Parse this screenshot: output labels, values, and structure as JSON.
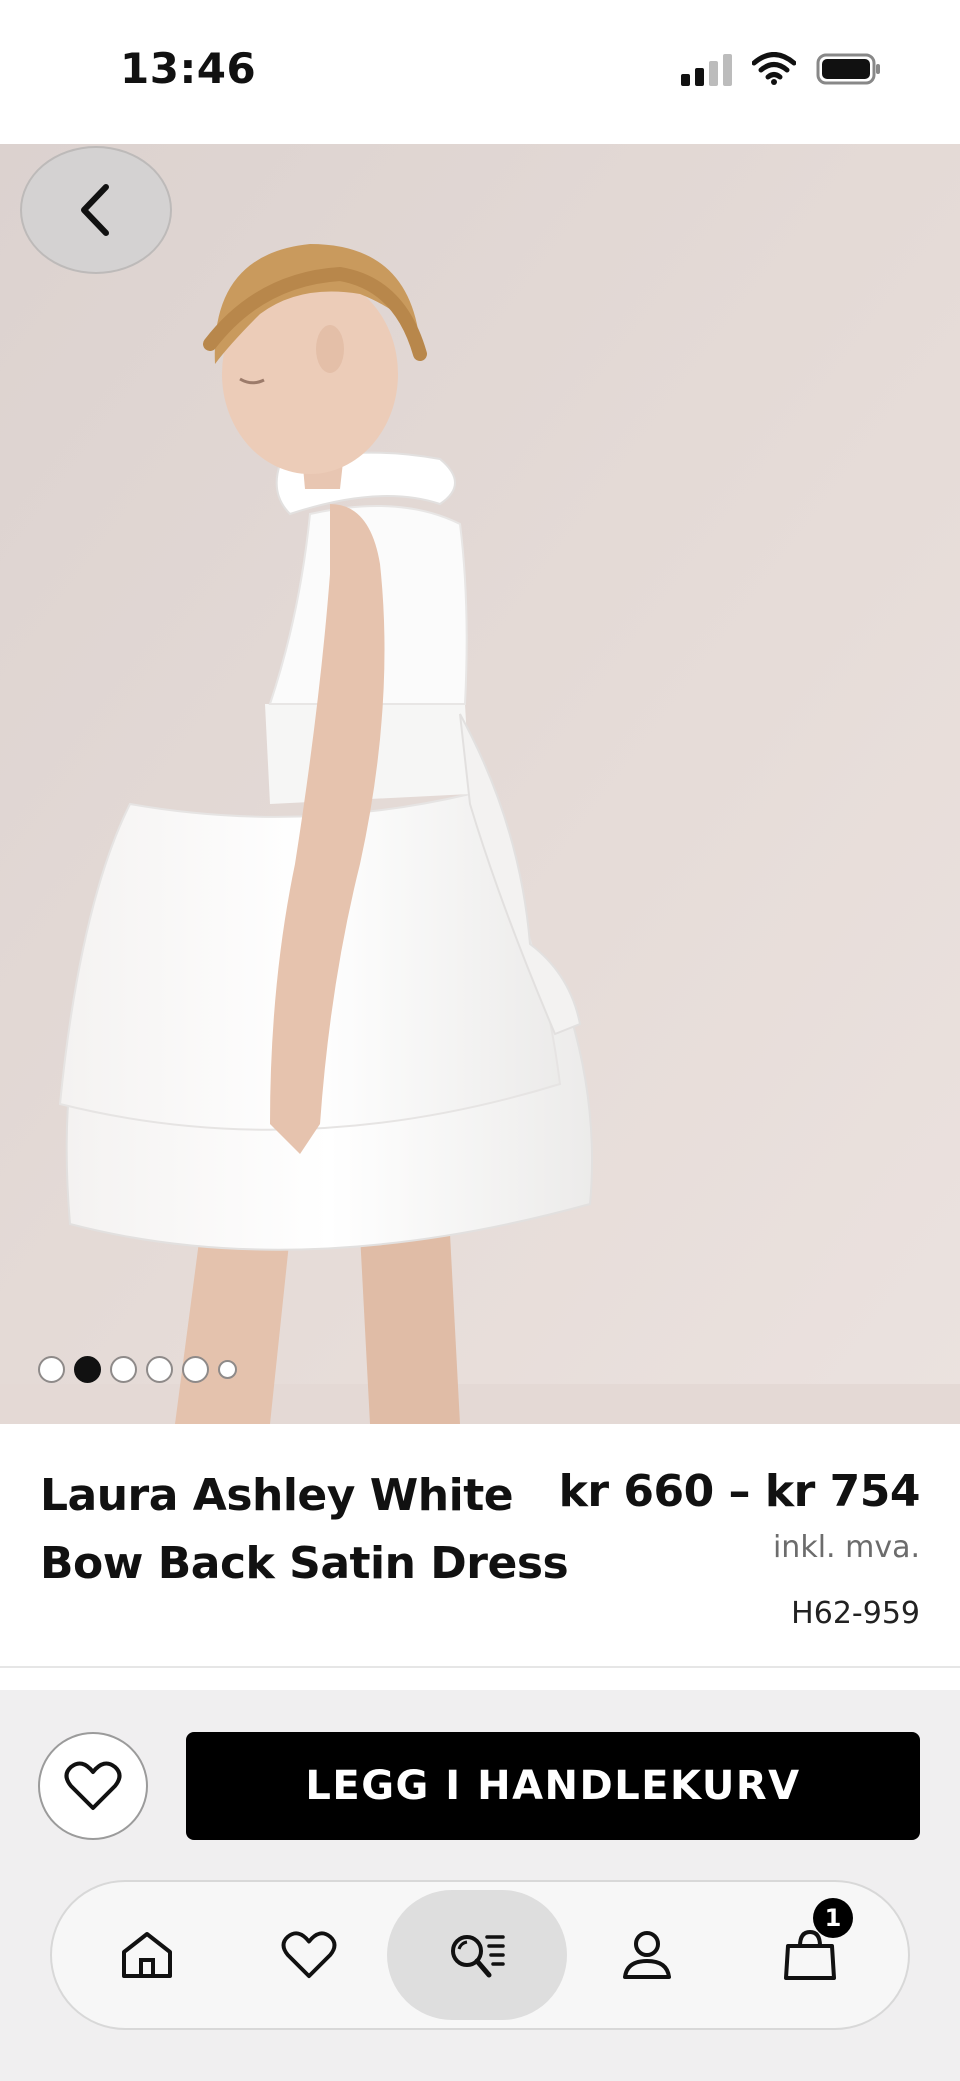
{
  "status_bar": {
    "time": "13:46"
  },
  "product": {
    "title": "Laura Ashley White Bow Back Satin Dress",
    "price_range": "kr 660 – kr 754",
    "price_note": "inkl. mva.",
    "sku": "H62-959"
  },
  "gallery": {
    "image_count": 6,
    "active_index": 1
  },
  "actions": {
    "add_to_cart_label": "LEGG I HANDLEKURV"
  },
  "nav": {
    "items": [
      {
        "icon": "home-icon"
      },
      {
        "icon": "heart-icon"
      },
      {
        "icon": "search-list-icon",
        "active": true
      },
      {
        "icon": "account-icon"
      },
      {
        "icon": "bag-icon",
        "badge": "1"
      }
    ]
  },
  "colors": {
    "accent": "#000000",
    "background": "#f0eff0"
  }
}
